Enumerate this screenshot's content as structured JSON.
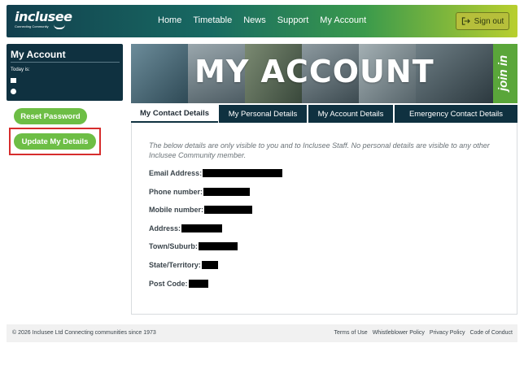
{
  "header": {
    "logo_text": "inclusee",
    "logo_tagline": "Connecting Community",
    "nav": [
      "Home",
      "Timetable",
      "News",
      "Support",
      "My Account"
    ],
    "signout_label": "Sign out"
  },
  "sidebar": {
    "panel_title": "My Account",
    "today_label": "Today is:",
    "buttons": {
      "reset_password": "Reset Password",
      "update_details": "Update My Details"
    }
  },
  "banner": {
    "title": "MY ACCOUNT",
    "badge": "join in"
  },
  "tabs": [
    {
      "label": "My Contact Details",
      "active": true
    },
    {
      "label": "My Personal Details",
      "active": false
    },
    {
      "label": "My Account Details",
      "active": false
    },
    {
      "label": "Emergency Contact Details",
      "active": false
    }
  ],
  "contact": {
    "note": "The below details are only visible to you and to Inclusee Staff. No personal details are visible to any other Inclusee Community member.",
    "fields": [
      {
        "label": "Email Address:"
      },
      {
        "label": "Phone number:"
      },
      {
        "label": "Mobile number:"
      },
      {
        "label": "Address:"
      },
      {
        "label": "Town/Suburb:"
      },
      {
        "label": "State/Territory:"
      },
      {
        "label": "Post Code:"
      }
    ]
  },
  "footer": {
    "copyright": "© 2026 Inclusee Ltd Connecting communities since 1973",
    "links": [
      "Terms of Use",
      "Whistleblower Policy",
      "Privacy Policy",
      "Code of Conduct"
    ]
  },
  "colors": {
    "navy": "#0f3140",
    "green": "#6dbe45",
    "highlight": "#d62d2d",
    "signout_bg": "#b6bf3b"
  },
  "icons": {
    "calendar": "calendar-icon",
    "clock": "clock-icon",
    "signout": "sign-out-icon"
  }
}
